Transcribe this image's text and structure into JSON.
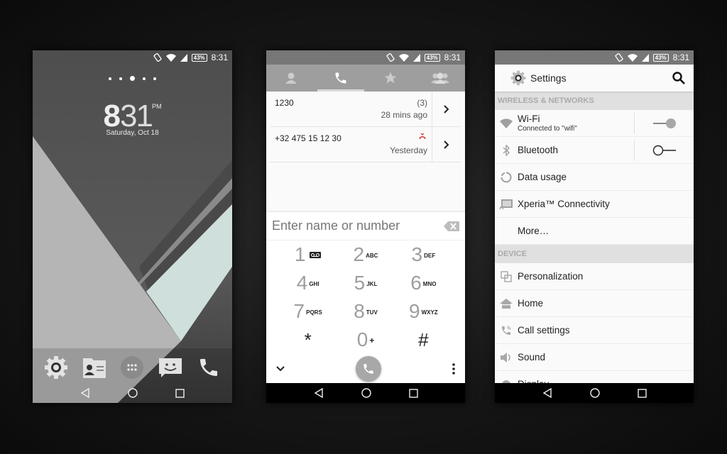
{
  "status_bar": {
    "battery": "43%",
    "time": "8:31",
    "icons": [
      "vibrate-icon",
      "wifi-icon",
      "signal-icon",
      "battery-icon"
    ]
  },
  "lockscreen": {
    "page_indicator": {
      "count": 5,
      "active_index": 2
    },
    "clock": {
      "hour": "8",
      "minutes": "31",
      "ampm": "PM"
    },
    "date": "Saturday, Oct 18",
    "dock": [
      "settings-icon",
      "contacts-icon",
      "app-drawer-icon",
      "messaging-icon",
      "phone-icon"
    ],
    "colors": {
      "dark": "#5c5c5c",
      "light": "#b4b4b4",
      "mint": "#cfdfdb"
    }
  },
  "dialer": {
    "tabs": [
      {
        "name": "contacts",
        "icon": "person-icon",
        "active": false
      },
      {
        "name": "call-log",
        "icon": "phone-icon",
        "active": true
      },
      {
        "name": "favorites",
        "icon": "star-icon",
        "active": false
      },
      {
        "name": "groups",
        "icon": "group-icon",
        "active": false
      }
    ],
    "calls": [
      {
        "number": "1230",
        "count": "(3)",
        "time": "28 mins ago",
        "missed": false
      },
      {
        "number": "+32 475 15 12 30",
        "count": "",
        "time": "Yesterday",
        "missed": true
      }
    ],
    "input_placeholder": "Enter name or number",
    "keys": [
      {
        "digit": "1",
        "letters": "",
        "voicemail": true
      },
      {
        "digit": "2",
        "letters": "ABC"
      },
      {
        "digit": "3",
        "letters": "DEF"
      },
      {
        "digit": "4",
        "letters": "GHI"
      },
      {
        "digit": "5",
        "letters": "JKL"
      },
      {
        "digit": "6",
        "letters": "MNO"
      },
      {
        "digit": "7",
        "letters": "PQRS"
      },
      {
        "digit": "8",
        "letters": "TUV"
      },
      {
        "digit": "9",
        "letters": "WXYZ"
      },
      {
        "digit": "*",
        "letters": ""
      },
      {
        "digit": "0",
        "letters": "+"
      },
      {
        "digit": "#",
        "letters": ""
      }
    ]
  },
  "settings": {
    "title": "Settings",
    "sections": [
      {
        "header": "WIRELESS & NETWORKS",
        "items": [
          {
            "label": "Wi-Fi",
            "sub": "Connected to \"wifi\"",
            "icon": "wifi-icon",
            "toggle": "on"
          },
          {
            "label": "Bluetooth",
            "icon": "bluetooth-icon",
            "toggle": "off"
          },
          {
            "label": "Data usage",
            "icon": "data-usage-icon"
          },
          {
            "label": "Xperia™ Connectivity",
            "icon": "cast-icon"
          },
          {
            "label": "More…",
            "icon": ""
          }
        ]
      },
      {
        "header": "DEVICE",
        "items": [
          {
            "label": "Personalization",
            "icon": "personalization-icon"
          },
          {
            "label": "Home",
            "icon": "home-icon"
          },
          {
            "label": "Call settings",
            "icon": "call-settings-icon"
          },
          {
            "label": "Sound",
            "icon": "sound-icon"
          },
          {
            "label": "Display",
            "icon": "display-icon"
          }
        ]
      }
    ]
  }
}
